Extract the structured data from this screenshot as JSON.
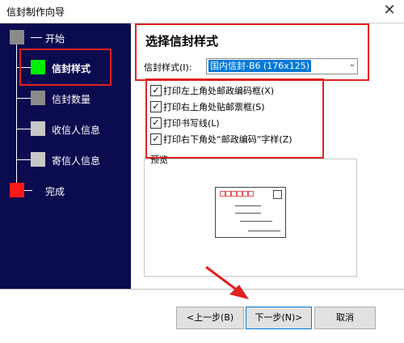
{
  "window": {
    "title": "信封制作向导",
    "close_label": "✕"
  },
  "steps": [
    {
      "label": "开始",
      "color": "#8a8a8a"
    },
    {
      "label": "信封样式",
      "color": "#00ee00"
    },
    {
      "label": "信封数量",
      "color": "#8a8a8a"
    },
    {
      "label": "收信人信息",
      "color": "#c8c8c8"
    },
    {
      "label": "寄信人信息",
      "color": "#c8c8c8"
    },
    {
      "label": "完成",
      "color": "#ff1a1a"
    }
  ],
  "main": {
    "heading": "选择信封样式",
    "style_label": "信封样式(I):",
    "style_value": "国内信封-B6 (176x125)",
    "options": [
      {
        "label": "打印左上角处邮政编码框(X)",
        "checked": true
      },
      {
        "label": "打印右上角处贴邮票框(S)",
        "checked": true
      },
      {
        "label": "打印书写线(L)",
        "checked": true
      },
      {
        "label": "打印右下角处“邮政编码”字样(Z)",
        "checked": true
      }
    ],
    "preview_label": "预览"
  },
  "buttons": {
    "back": "<上一步(B)",
    "next": "下一步(N)>",
    "cancel": "取消"
  },
  "colors": {
    "sidebar": "#0b0b4f",
    "annotation": "#e02020"
  }
}
